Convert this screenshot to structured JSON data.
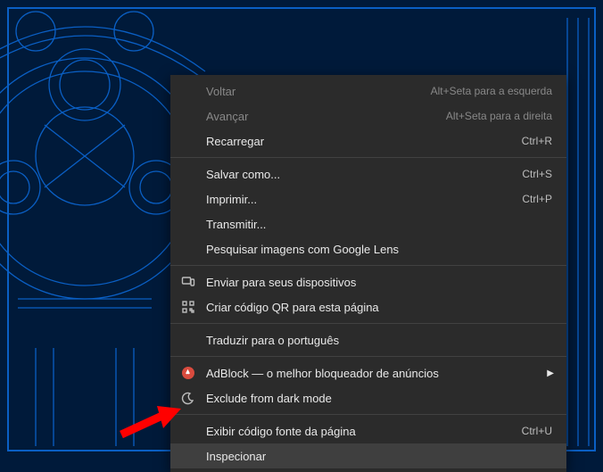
{
  "menu": {
    "items": [
      {
        "label": "Voltar",
        "shortcut": "Alt+Seta para a esquerda",
        "disabled": true
      },
      {
        "label": "Avançar",
        "shortcut": "Alt+Seta para a direita",
        "disabled": true
      },
      {
        "label": "Recarregar",
        "shortcut": "Ctrl+R"
      }
    ],
    "group2": [
      {
        "label": "Salvar como...",
        "shortcut": "Ctrl+S"
      },
      {
        "label": "Imprimir...",
        "shortcut": "Ctrl+P"
      },
      {
        "label": "Transmitir..."
      },
      {
        "label": "Pesquisar imagens com Google Lens"
      }
    ],
    "group3": [
      {
        "label": "Enviar para seus dispositivos",
        "icon": "devices"
      },
      {
        "label": "Criar código QR para esta página",
        "icon": "qr"
      }
    ],
    "group4": [
      {
        "label": "Traduzir para o português"
      }
    ],
    "group5": [
      {
        "label": "AdBlock — o melhor bloqueador de anúncios",
        "icon": "adblock",
        "submenu": true
      },
      {
        "label": "Exclude from dark mode",
        "icon": "moon"
      }
    ],
    "group6": [
      {
        "label": "Exibir código fonte da página",
        "shortcut": "Ctrl+U"
      },
      {
        "label": "Inspecionar",
        "hovered": true
      }
    ]
  }
}
